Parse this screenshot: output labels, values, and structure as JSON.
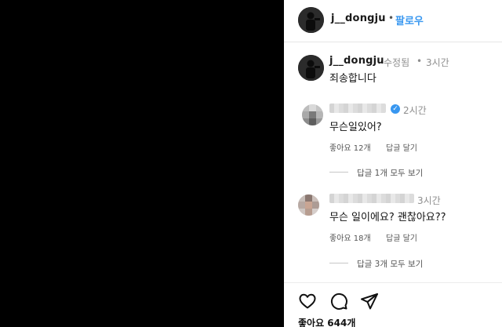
{
  "header": {
    "username": "j__dongju",
    "separator": "•",
    "follow_label": "팔로우"
  },
  "caption": {
    "username": "j__dongju",
    "edited_label": "수정됨",
    "separator": "•",
    "time": "3시간",
    "text": "죄송합니다"
  },
  "comments": [
    {
      "time": "2시간",
      "text": "무슨일있어?",
      "likes_label": "좋아요 12개",
      "reply_label": "답글 달기",
      "view_replies_label": "답글 1개 모두 보기"
    },
    {
      "time": "3시간",
      "text": "무슨 일이에요? 괜찮아요??",
      "likes_label": "좋아요 18개",
      "reply_label": "답글 달기",
      "view_replies_label": "답글 3개 모두 보기"
    }
  ],
  "actions": {
    "icons": [
      "heart-icon",
      "comment-icon",
      "share-icon"
    ],
    "likes_label": "좋아요 644개"
  },
  "colors": {
    "background": "#000000",
    "panel": "#ffffff",
    "link_blue": "#3897f0",
    "verified_blue": "#3897f0",
    "muted_text": "#8e8e8e"
  }
}
